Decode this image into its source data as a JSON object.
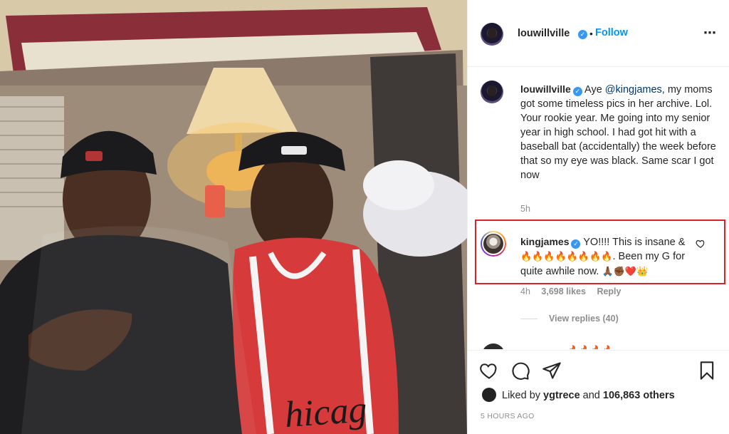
{
  "post": {
    "author": "louwillville",
    "follow_label": "Follow",
    "more_icon": "⋯",
    "separator": "•"
  },
  "caption": {
    "username": "louwillville",
    "text_before": "Aye ",
    "mention": "@kingjames",
    "text_after": ", my moms got some timeless pics in her archive. Lol. Your rookie year. Me going into my senior year in high school. I had got hit with a baseball bat (accidentally) the week before that so my eye was black. Same scar I got now",
    "time": "5h"
  },
  "highlighted_comment": {
    "username": "kingjames",
    "text_start": "YO!!!! This is insane &",
    "fire_emoji": "🔥🔥🔥🔥🔥🔥🔥🔥",
    "text_mid": ". Been my G for quite awhile now.",
    "end_emoji": "🙏🏾✊🏾❤️👑",
    "time": "4h",
    "likes": "3,698 likes",
    "reply_label": "Reply",
    "view_replies": "View replies (40)",
    "highlight_color": "#d8232a"
  },
  "next_comment_partial": {
    "text": "🔥🔥🔥🔥"
  },
  "actions": {
    "icons": [
      "heart-icon",
      "comment-icon",
      "share-icon",
      "bookmark-icon"
    ]
  },
  "likes_summary": {
    "prefix": "Liked by ",
    "user": "ygtrece",
    "middle": " and ",
    "count": "106,863 others"
  },
  "timestamp": "5 HOURS AGO",
  "colors": {
    "link_blue": "#0095f6",
    "mention_blue": "#00376b",
    "verified_blue": "#3897f0",
    "muted_gray": "#8e8e8e"
  }
}
